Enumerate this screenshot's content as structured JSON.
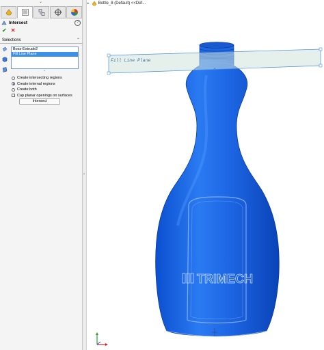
{
  "feature_manager": {
    "tabs": [
      {
        "name": "featuremanager-tab",
        "icon": "feature-tree-icon"
      },
      {
        "name": "propertymanager-tab",
        "icon": "property-list-icon"
      },
      {
        "name": "configurationmanager-tab",
        "icon": "configuration-icon"
      },
      {
        "name": "dimxpert-tab",
        "icon": "crosshair-icon"
      },
      {
        "name": "display-manager-tab",
        "icon": "appearance-sphere-icon"
      }
    ]
  },
  "property_manager": {
    "title": "Intersect",
    "help": "?",
    "ok_label": "✔",
    "cancel_label": "✕",
    "selections_label": "Selections",
    "selections": [
      {
        "label": "Boss-Extrude2",
        "selected": false
      },
      {
        "label": "Fill Line Plane",
        "selected": true
      }
    ],
    "options": [
      {
        "label": "Create intersecting regions",
        "type": "radio",
        "checked": false
      },
      {
        "label": "Create internal regions",
        "type": "radio",
        "checked": true
      },
      {
        "label": "Create both",
        "type": "radio",
        "checked": false
      },
      {
        "label": "Cap planar openings on surfaces",
        "type": "checkbox",
        "checked": false
      }
    ],
    "intersect_button": "Intersect"
  },
  "viewport": {
    "breadcrumb": "Bottle_8 (Default) <<Def...",
    "plane_label": "Fill Line Plane",
    "logo_text": "TRIMECH",
    "part_color": "#1f6be0",
    "plane_color": "#cfe3dc"
  }
}
